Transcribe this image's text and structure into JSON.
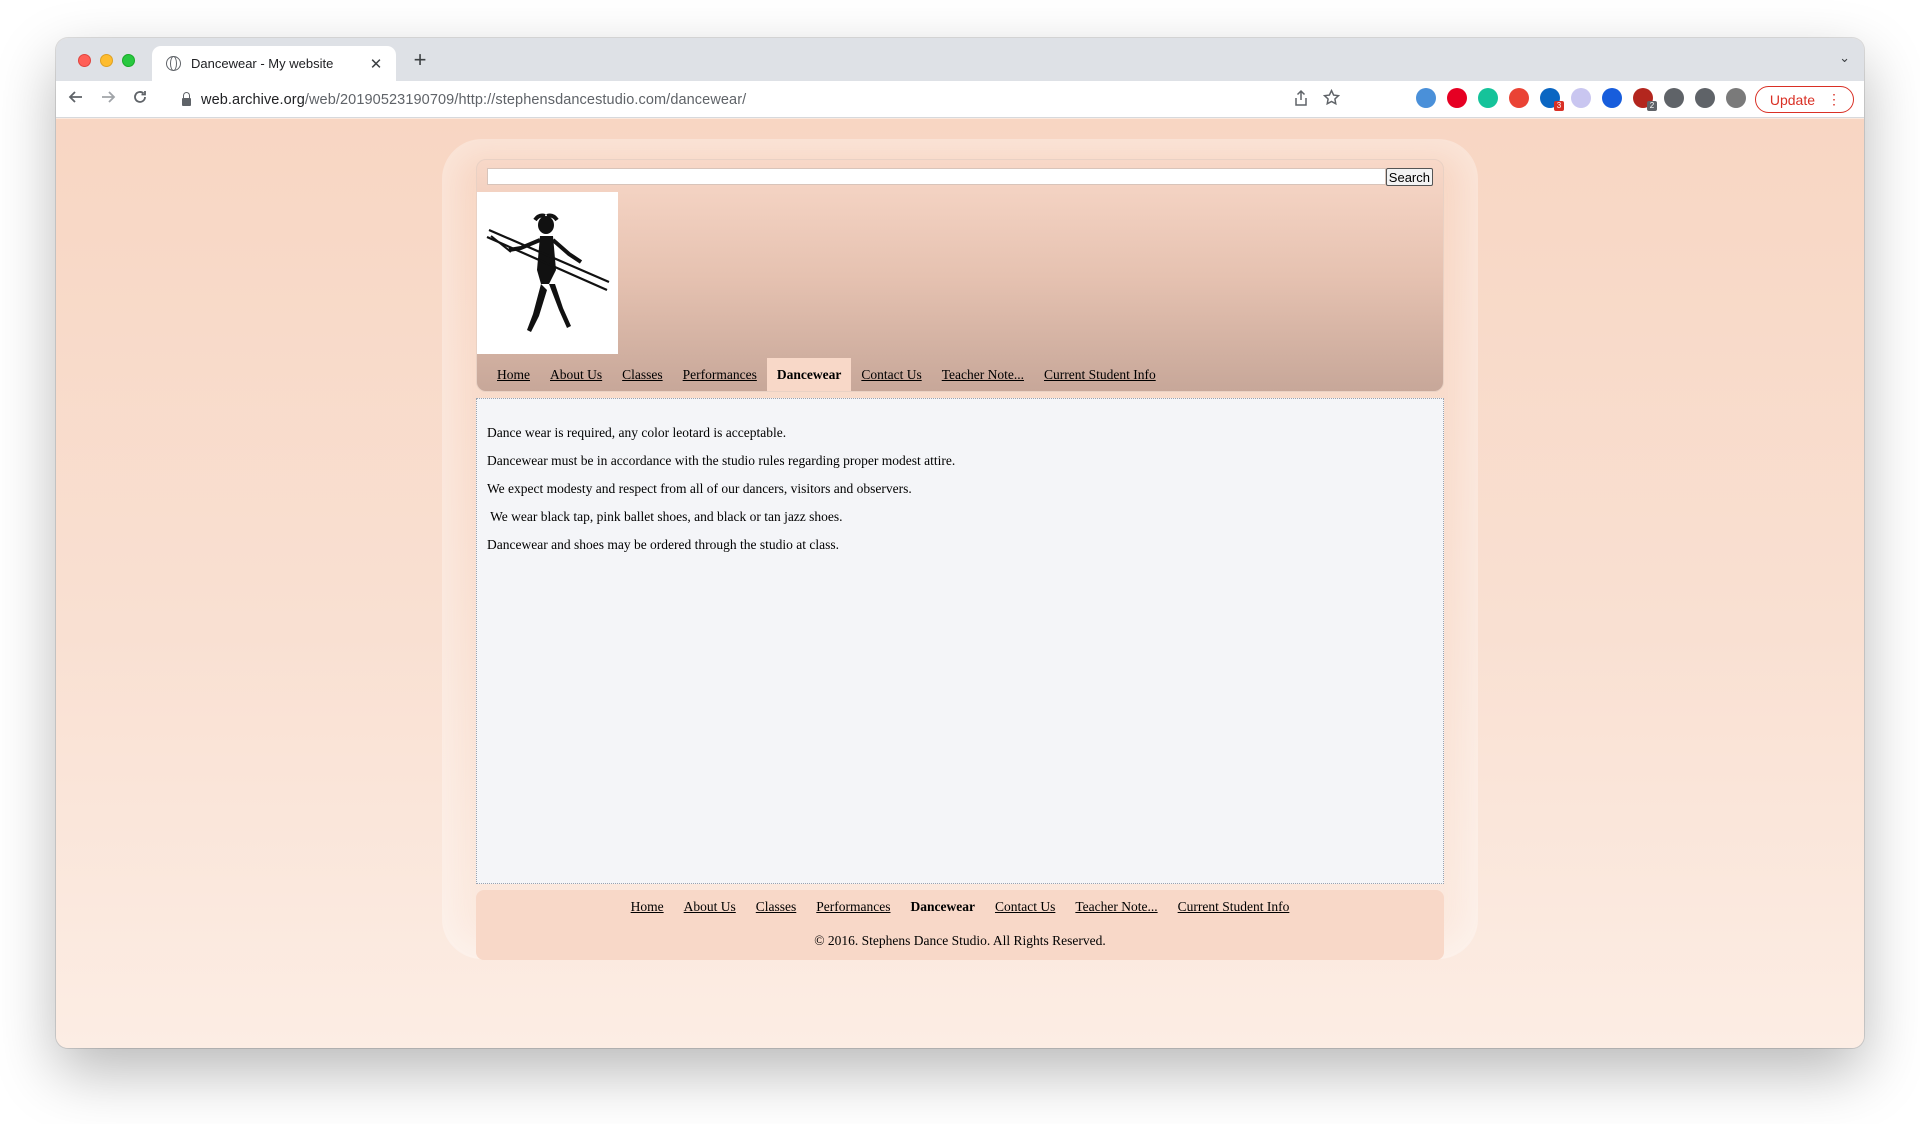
{
  "browser": {
    "tab_title": "Dancewear - My website",
    "close_glyph": "✕",
    "new_tab_glyph": "+",
    "tab_search_glyph": "⌄",
    "url_host": "web.archive.org",
    "url_path": "/web/20190523190709/http://stephensdancestudio.com/dancewear/",
    "update_label": "Update",
    "menu_glyph": "⋮",
    "extensions": [
      {
        "name": "extension-1-icon",
        "color": "#4a90d9",
        "badge": ""
      },
      {
        "name": "pinterest-icon",
        "color": "#e60023",
        "badge": ""
      },
      {
        "name": "grammarly-icon",
        "color": "#15c39a",
        "badge": ""
      },
      {
        "name": "gmail-icon",
        "color": "#ea4335",
        "badge": ""
      },
      {
        "name": "linkedin-icon",
        "color": "#0a66c2",
        "badge": "3"
      },
      {
        "name": "extension-6-icon",
        "color": "#c9c6f0",
        "badge": ""
      },
      {
        "name": "bitwarden-icon",
        "color": "#175ddc",
        "badge": ""
      },
      {
        "name": "shield-extension-icon",
        "color": "#b3261e",
        "badge": "2"
      },
      {
        "name": "puzzle-icon",
        "color": "#5f6368",
        "badge": ""
      },
      {
        "name": "reading-list-icon",
        "color": "#5f6368",
        "badge": ""
      },
      {
        "name": "profile-avatar-icon",
        "color": "#7a7a7a",
        "badge": ""
      }
    ]
  },
  "site": {
    "search_button": "Search",
    "nav": [
      {
        "label": "Home",
        "active": false
      },
      {
        "label": "About Us",
        "active": false
      },
      {
        "label": "Classes",
        "active": false
      },
      {
        "label": "Performances",
        "active": false
      },
      {
        "label": "Dancewear",
        "active": true
      },
      {
        "label": "Contact Us",
        "active": false
      },
      {
        "label": "Teacher Note...",
        "active": false
      },
      {
        "label": "Current Student Info",
        "active": false
      }
    ],
    "paragraphs": [
      "Dance wear is required, any color leotard is acceptable.",
      "Dancewear must be in accordance with the studio rules regarding proper modest attire.",
      "We expect modesty and respect from all of our dancers, visitors and observers.",
      " We wear black tap, pink ballet shoes, and black or tan jazz shoes.",
      "Dancewear and shoes may be ordered through the studio at class."
    ],
    "copyright": "© 2016. Stephens Dance Studio. All Rights Reserved."
  }
}
